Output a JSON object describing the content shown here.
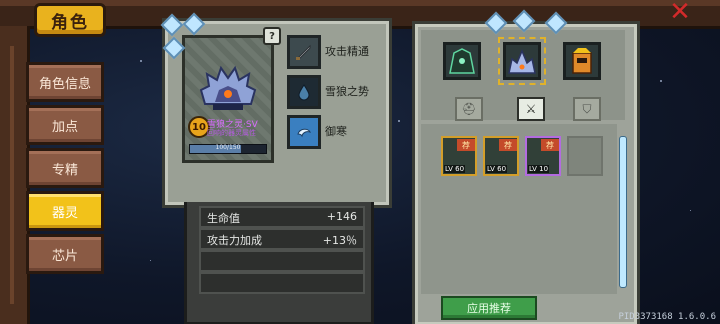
{
  "header": {
    "title": "角色",
    "close_icon": "close-x-icon",
    "accent_color": "#e9b21e",
    "close_color": "#d22a2a"
  },
  "sidebar": {
    "items": [
      {
        "label": "角色信息",
        "active": false
      },
      {
        "label": "加点",
        "active": false
      },
      {
        "label": "专精",
        "active": false
      },
      {
        "label": "器灵",
        "active": true
      },
      {
        "label": "芯片",
        "active": false
      }
    ],
    "active_color": "#f2c21a"
  },
  "pet_card": {
    "level": "10",
    "name": "雪狼之灵·SV",
    "subtitle": "回响的器灵属性",
    "xp_text": "100/150",
    "xp_fraction": 0.667,
    "help_label": "?"
  },
  "skills": [
    {
      "label": "攻击精通",
      "icon": "sword-skill-icon"
    },
    {
      "label": "雪狼之势",
      "icon": "water-drop-skill-icon"
    },
    {
      "label": "御寒",
      "icon": "frost-skill-icon"
    }
  ],
  "stats": [
    {
      "name": "生命值",
      "value": "+146"
    },
    {
      "name": "攻击力加成",
      "value": "+13％"
    },
    {
      "name": "",
      "value": ""
    },
    {
      "name": "",
      "value": ""
    }
  ],
  "equipped_slots": [
    {
      "icon": "dark-crystal-pet-icon",
      "selected": false
    },
    {
      "icon": "ice-wolf-pet-icon",
      "selected": true
    },
    {
      "icon": "orange-golem-pet-icon",
      "selected": false
    }
  ],
  "categories": [
    {
      "icon": "helmet-icon",
      "active": false
    },
    {
      "icon": "sword-icon",
      "active": true
    },
    {
      "icon": "shield-icon",
      "active": false
    }
  ],
  "inventory": [
    {
      "level": "LV 60",
      "tag": "荐",
      "border": "gold"
    },
    {
      "level": "LV 60",
      "tag": "荐",
      "border": "gold"
    },
    {
      "level": "LV 10",
      "tag": "荐",
      "border": "purple"
    },
    {
      "level": "",
      "tag": "",
      "border": "empty"
    }
  ],
  "apply_button": "应用推荐",
  "pid": "PID3373168 1.6.0.6"
}
